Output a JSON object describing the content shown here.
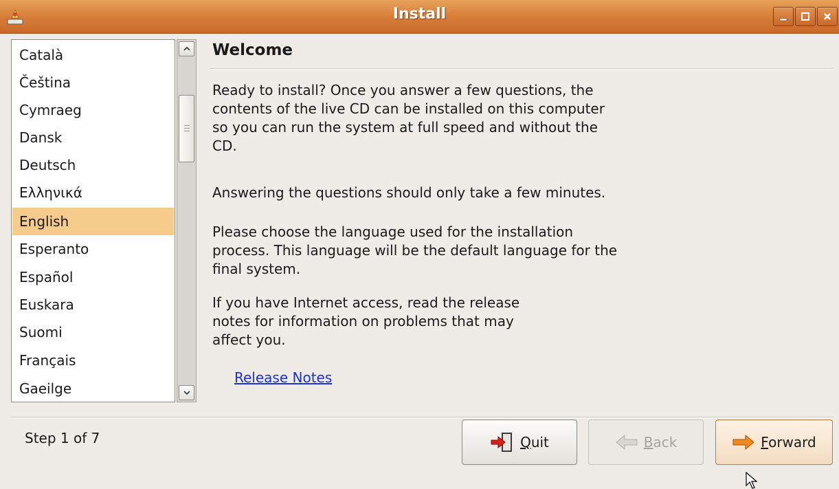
{
  "window": {
    "title": "Install"
  },
  "languages": [
    "Català",
    "Čeština",
    "Cymraeg",
    "Dansk",
    "Deutsch",
    "Ελληνικά",
    "English",
    "Esperanto",
    "Español",
    "Euskara",
    "Suomi",
    "Français",
    "Gaeilge"
  ],
  "selected_language": "English",
  "welcome": {
    "heading": "Welcome",
    "para1_lines": [
      "Ready to install? Once you answer a few questions, the",
      "contents of the live CD can be installed on this computer",
      "so you can run the system at full speed and without the",
      "CD."
    ],
    "para2": "Answering the questions should only take a few minutes.",
    "para3_lines": [
      "Please choose the language used for the installation",
      "process. This language will be the default language for the",
      "final system."
    ],
    "para4_lines": [
      "If you have Internet access, read the release",
      "notes for information on problems that may",
      "affect you."
    ],
    "release_notes_link": "Release Notes"
  },
  "footer": {
    "step": "Step 1 of 7",
    "quit": {
      "mnemonic": "Q",
      "rest": "uit"
    },
    "back": {
      "mnemonic": "B",
      "rest": "ack"
    },
    "forward": {
      "mnemonic": "F",
      "rest": "orward"
    }
  },
  "colors": {
    "titlebar": "#d9823c",
    "selection": "#f6cc8d",
    "link": "#1f2fd6"
  }
}
